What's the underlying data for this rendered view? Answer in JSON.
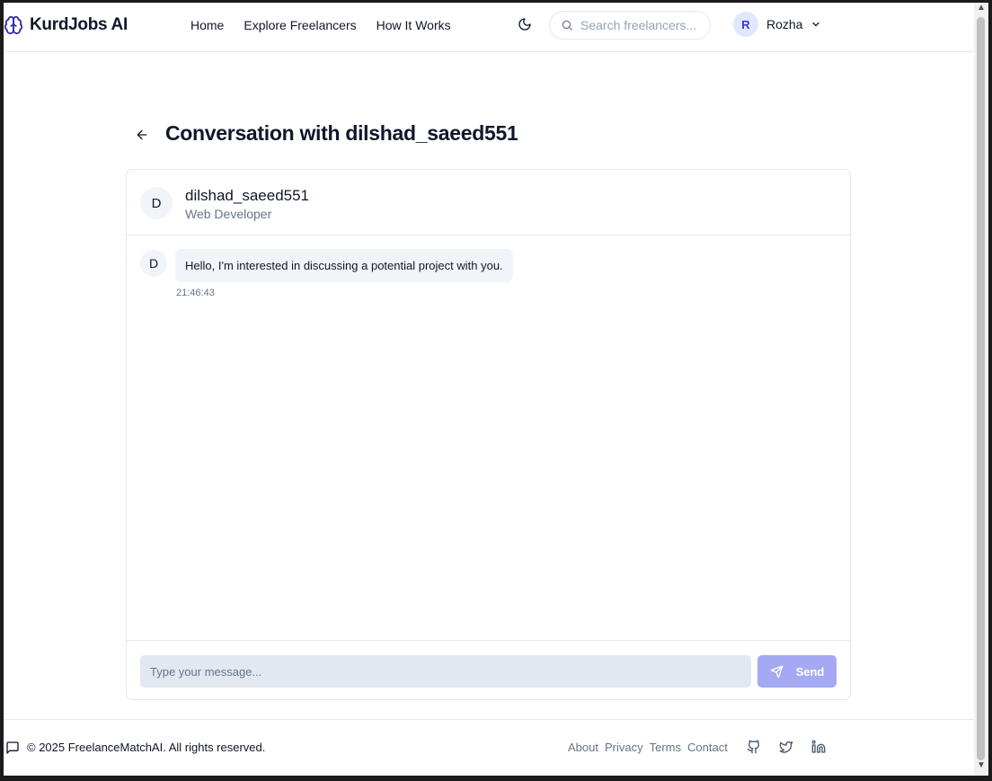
{
  "header": {
    "brand": "KurdJobs AI",
    "nav": [
      {
        "label": "Home"
      },
      {
        "label": "Explore Freelancers"
      },
      {
        "label": "How It Works"
      }
    ],
    "search_placeholder": "Search freelancers...",
    "user": {
      "initial": "R",
      "name": "Rozha"
    }
  },
  "page": {
    "title": "Conversation with dilshad_saeed551"
  },
  "conversation": {
    "contact": {
      "initial": "D",
      "name": "dilshad_saeed551",
      "role": "Web Developer"
    },
    "messages": [
      {
        "sender_initial": "D",
        "text": "Hello, I'm interested in discussing a potential project with you.",
        "time": "21:46:43"
      }
    ],
    "composer": {
      "placeholder": "Type your message...",
      "send_label": "Send"
    }
  },
  "footer": {
    "copyright": "© 2025 FreelanceMatchAI. All rights reserved.",
    "links": [
      {
        "label": "About"
      },
      {
        "label": "Privacy"
      },
      {
        "label": "Terms"
      },
      {
        "label": "Contact"
      }
    ],
    "social": [
      "github-icon",
      "twitter-icon",
      "linkedin-icon"
    ]
  },
  "colors": {
    "brand": "#3730a3",
    "send_button": "#a5a8f3",
    "muted_text": "#64748b",
    "bubble_bg": "#f1f5f9"
  }
}
